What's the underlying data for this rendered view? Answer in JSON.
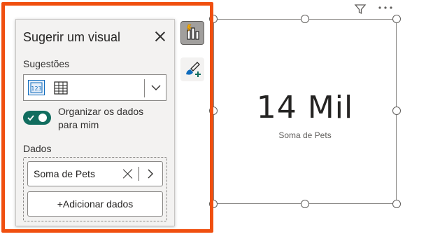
{
  "suggest_pane": {
    "title": "Sugerir um visual",
    "suggestions_label": "Sugestões",
    "suggestion_icons": [
      "card-icon",
      "table-icon"
    ],
    "organize_toggle": {
      "label": "Organizar os dados para mim",
      "on": true
    },
    "data_label": "Dados",
    "fields": [
      {
        "name": "Soma de Pets"
      }
    ],
    "add_data_label": "+Adicionar dados"
  },
  "side_buttons": [
    "visualization-suggest-icon",
    "format-paintbrush-icon"
  ],
  "visual_header_icons": [
    "filter-icon",
    "more-options-icon"
  ],
  "card": {
    "value": "14 Mil",
    "label": "Soma de Pets"
  },
  "colors": {
    "highlight": "#f04f0f",
    "toggle_on": "#116d5f",
    "accent_blue": "#0f6cbd"
  }
}
